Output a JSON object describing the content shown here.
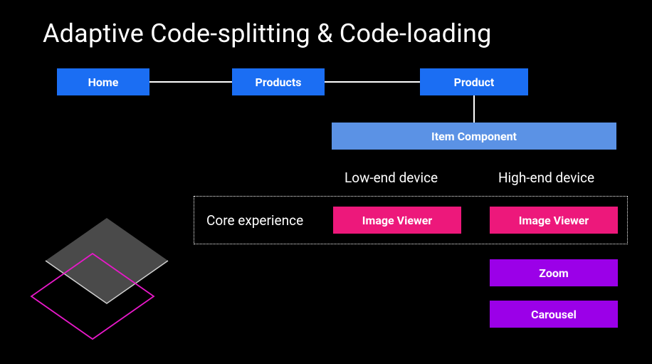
{
  "title": "Adaptive Code-splitting & Code-loading",
  "nav": {
    "home": "Home",
    "products": "Products",
    "product": "Product",
    "item_component": "Item Component"
  },
  "headings": {
    "low_end": "Low-end device",
    "high_end": "High-end device",
    "core_experience": "Core experience"
  },
  "components": {
    "image_viewer": "Image Viewer",
    "zoom": "Zoom",
    "carousel": "Carousel"
  }
}
